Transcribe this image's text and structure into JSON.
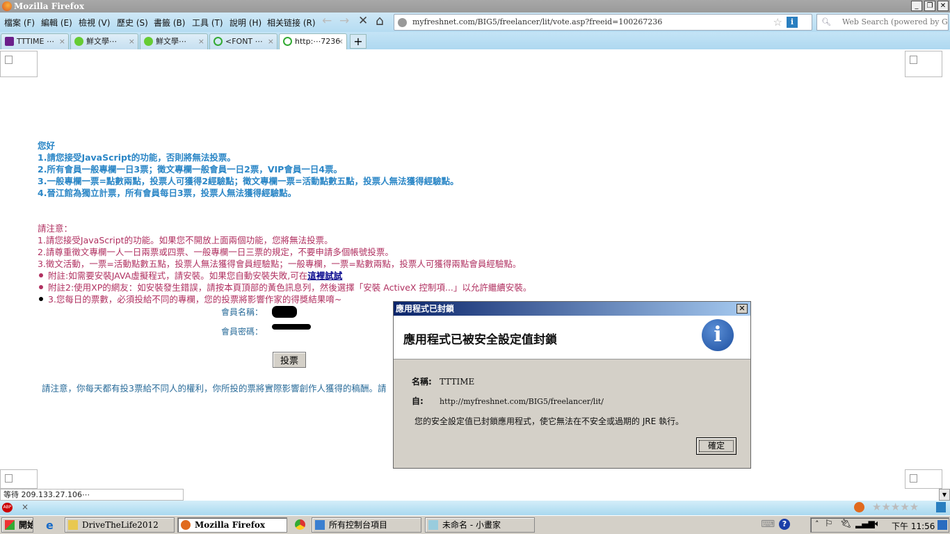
{
  "window": {
    "title": "Mozilla Firefox",
    "min": "_",
    "restore": "❐",
    "close": "✕"
  },
  "menu": [
    "檔案 (F)",
    "編輯 (E)",
    "檢視 (V)",
    "歷史 (S)",
    "書籤 (B)",
    "工具 (T)",
    "說明 (H)",
    "相关链接 (R)"
  ],
  "nav": {
    "back": "←",
    "forward": "→",
    "stop": "✕",
    "home": "⌂",
    "url": "myfreshnet.com/BIG5/freelancer/lit/vote.asp?freeid=100267236",
    "search_placeholder": "Web Search (powered by G"
  },
  "tabs": [
    {
      "label": "TTTIME ⋯"
    },
    {
      "label": "鮮文學⋯"
    },
    {
      "label": "鮮文學⋯"
    },
    {
      "label": "<FONT ⋯"
    },
    {
      "label": "http:⋯7236"
    }
  ],
  "new_tab": "+",
  "page": {
    "greeting": "您好",
    "rules": [
      "1.請您接受JavaScript的功能，否則將無法投票。",
      "2.所有會員一般專欄一日3票；徵文專欄一般會員一日2票，VIP會員一日4票。",
      "3.一般專欄一票=點數兩點，投票人可獲得2經驗點；徵文專欄一票=活動點數五點，投票人無法獲得經驗點。",
      "4.晉江館為獨立計票，所有會員每日3票，投票人無法獲得經驗點。"
    ],
    "notice_title": "請注意：",
    "notices": [
      "1.請您接受JavaScript的功能。如果您不開放上面兩個功能，您將無法投票。",
      "2.請尊重徵文專欄一人一日兩票或四票、一般專欄一日三票的規定，不要申請多個帳號投票。",
      "3.徵文活動，一票=活動點數五點，投票人無法獲得會員經驗點；一般專欄，一票=點數兩點，投票人可獲得兩點會員經驗點。"
    ],
    "bullets": [
      {
        "text": "附註:如需要安裝JAVA虛擬程式，請安裝。如果您自動安裝失敗,可在",
        "link": "這裡試試"
      },
      {
        "text": "附註2:使用XP的網友：如安裝發生錯誤，請按本頁頂部的黃色訊息列，然後選擇「安裝 ActiveX 控制項...」以允許繼續安裝。"
      },
      {
        "text": "3.您每日的票數，必須投給不同的專欄，您的投票將影響作家的得獎結果唷~"
      }
    ],
    "username_label": "會員名稱：",
    "password_label": "會員密碼：",
    "vote_button": "投票",
    "footer_note": "請注意，你每天都有投3票給不同人的權利，你所投的票將實際影響創作人獲得的稿酬。請"
  },
  "dialog": {
    "title": "應用程式已封鎖",
    "close": "✕",
    "heading": "應用程式已被安全設定值封鎖",
    "name_label": "名稱:",
    "name_value": "TTTIME",
    "from_label": "自:",
    "from_value": "http://myfreshnet.com/BIG5/freelancer/lit/",
    "message": "您的安全設定值已封鎖應用程式，使它無法在不安全或過期的 JRE 執行。",
    "ok": "確定",
    "icon": "i"
  },
  "status": "等待 209.133.27.106⋯",
  "taskbar": {
    "start": "開始",
    "items": [
      "DriveTheLife2012",
      "Mozilla Firefox",
      "所有控制台項目",
      "未命名 - 小畫家"
    ],
    "clock": "下午 11:56"
  },
  "colors": {
    "blue_text": "#2a86c6",
    "red_text": "#b03060",
    "dialog_bg": "#d4d0c8"
  }
}
